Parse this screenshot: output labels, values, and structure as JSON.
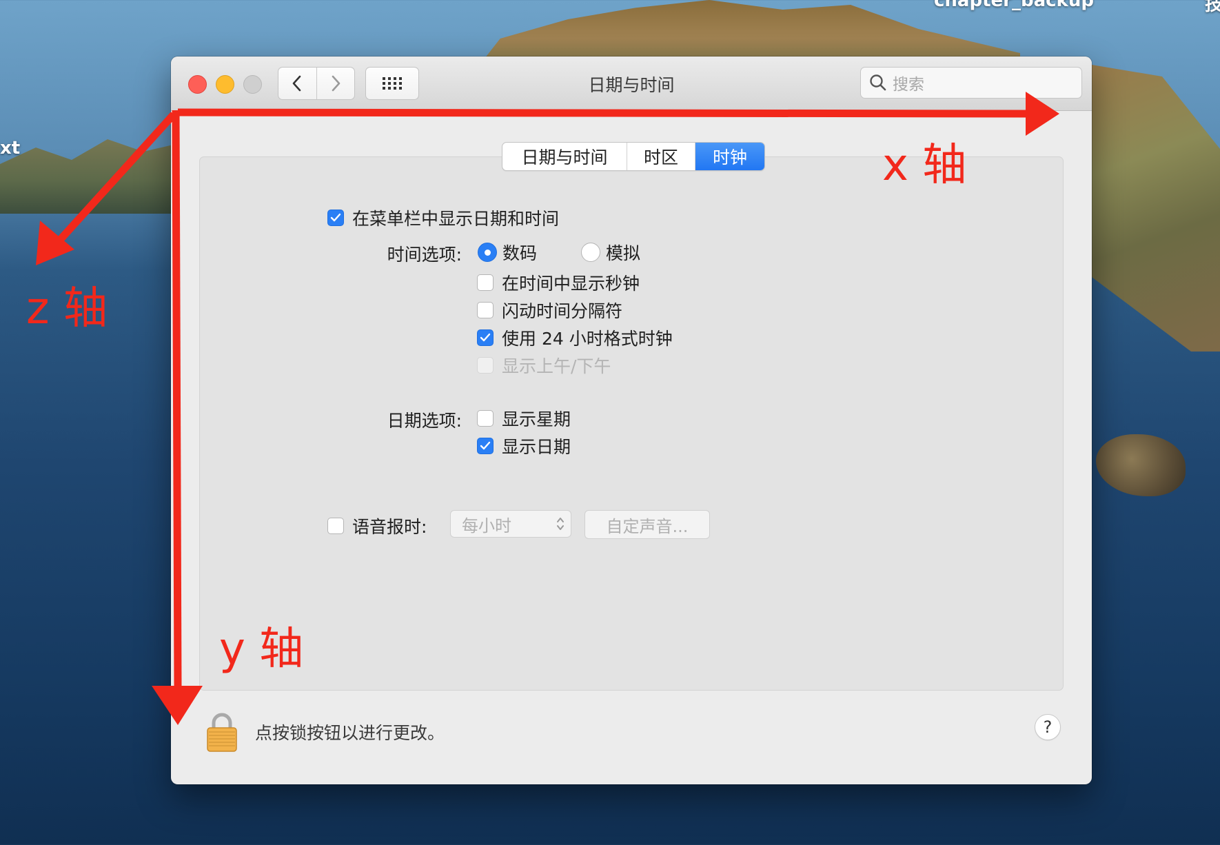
{
  "desktop": {
    "edge_label_left": "xt",
    "edge_label_top": "chapter_backup",
    "edge_label_right": "技"
  },
  "window": {
    "title": "日期与时间",
    "search_placeholder": "搜索",
    "tabs": [
      {
        "label": "日期与时间",
        "selected": false
      },
      {
        "label": "时区",
        "selected": false
      },
      {
        "label": "时钟",
        "selected": true
      }
    ],
    "show_in_menubar": {
      "label": "在菜单栏中显示日期和时间",
      "checked": true
    },
    "time_options": {
      "label": "时间选项:",
      "digital": {
        "label": "数码",
        "selected": true
      },
      "analog": {
        "label": "模拟",
        "selected": false
      },
      "show_seconds": {
        "label": "在时间中显示秒钟",
        "checked": false
      },
      "flash_separators": {
        "label": "闪动时间分隔符",
        "checked": false
      },
      "use_24h": {
        "label": "使用 24 小时格式时钟",
        "checked": true
      },
      "show_ampm": {
        "label": "显示上午/下午",
        "checked": false,
        "disabled": true
      }
    },
    "date_options": {
      "label": "日期选项:",
      "show_weekday": {
        "label": "显示星期",
        "checked": false
      },
      "show_date": {
        "label": "显示日期",
        "checked": true
      }
    },
    "announce": {
      "label": "语音报时:",
      "checked": false,
      "interval": "每小时",
      "custom_voice_button": "自定声音..."
    },
    "footer": {
      "lock_text": "点按锁按钮以进行更改。",
      "help": "?"
    }
  },
  "annotations": {
    "color": "#f2281b",
    "x_axis_label": "x 轴",
    "y_axis_label": "y 轴",
    "z_axis_label": "z 轴"
  }
}
